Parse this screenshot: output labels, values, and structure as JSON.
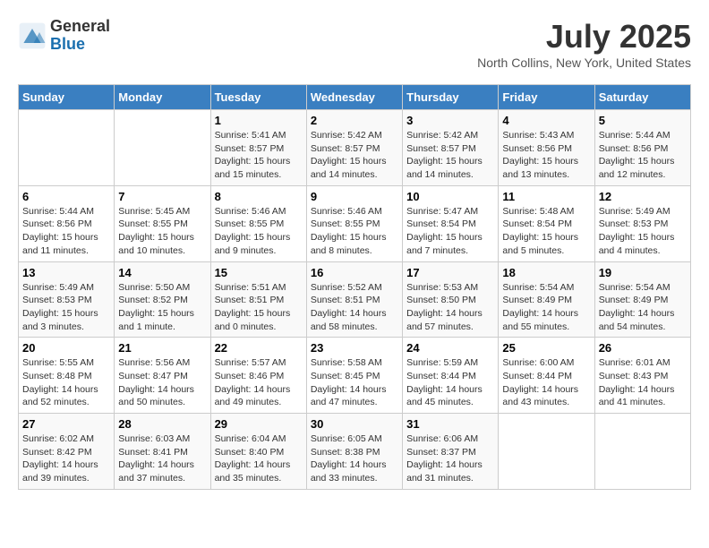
{
  "header": {
    "logo_general": "General",
    "logo_blue": "Blue",
    "title": "July 2025",
    "location": "North Collins, New York, United States"
  },
  "days_of_week": [
    "Sunday",
    "Monday",
    "Tuesday",
    "Wednesday",
    "Thursday",
    "Friday",
    "Saturday"
  ],
  "weeks": [
    [
      {
        "day": "",
        "info": ""
      },
      {
        "day": "",
        "info": ""
      },
      {
        "day": "1",
        "info": "Sunrise: 5:41 AM\nSunset: 8:57 PM\nDaylight: 15 hours and 15 minutes."
      },
      {
        "day": "2",
        "info": "Sunrise: 5:42 AM\nSunset: 8:57 PM\nDaylight: 15 hours and 14 minutes."
      },
      {
        "day": "3",
        "info": "Sunrise: 5:42 AM\nSunset: 8:57 PM\nDaylight: 15 hours and 14 minutes."
      },
      {
        "day": "4",
        "info": "Sunrise: 5:43 AM\nSunset: 8:56 PM\nDaylight: 15 hours and 13 minutes."
      },
      {
        "day": "5",
        "info": "Sunrise: 5:44 AM\nSunset: 8:56 PM\nDaylight: 15 hours and 12 minutes."
      }
    ],
    [
      {
        "day": "6",
        "info": "Sunrise: 5:44 AM\nSunset: 8:56 PM\nDaylight: 15 hours and 11 minutes."
      },
      {
        "day": "7",
        "info": "Sunrise: 5:45 AM\nSunset: 8:55 PM\nDaylight: 15 hours and 10 minutes."
      },
      {
        "day": "8",
        "info": "Sunrise: 5:46 AM\nSunset: 8:55 PM\nDaylight: 15 hours and 9 minutes."
      },
      {
        "day": "9",
        "info": "Sunrise: 5:46 AM\nSunset: 8:55 PM\nDaylight: 15 hours and 8 minutes."
      },
      {
        "day": "10",
        "info": "Sunrise: 5:47 AM\nSunset: 8:54 PM\nDaylight: 15 hours and 7 minutes."
      },
      {
        "day": "11",
        "info": "Sunrise: 5:48 AM\nSunset: 8:54 PM\nDaylight: 15 hours and 5 minutes."
      },
      {
        "day": "12",
        "info": "Sunrise: 5:49 AM\nSunset: 8:53 PM\nDaylight: 15 hours and 4 minutes."
      }
    ],
    [
      {
        "day": "13",
        "info": "Sunrise: 5:49 AM\nSunset: 8:53 PM\nDaylight: 15 hours and 3 minutes."
      },
      {
        "day": "14",
        "info": "Sunrise: 5:50 AM\nSunset: 8:52 PM\nDaylight: 15 hours and 1 minute."
      },
      {
        "day": "15",
        "info": "Sunrise: 5:51 AM\nSunset: 8:51 PM\nDaylight: 15 hours and 0 minutes."
      },
      {
        "day": "16",
        "info": "Sunrise: 5:52 AM\nSunset: 8:51 PM\nDaylight: 14 hours and 58 minutes."
      },
      {
        "day": "17",
        "info": "Sunrise: 5:53 AM\nSunset: 8:50 PM\nDaylight: 14 hours and 57 minutes."
      },
      {
        "day": "18",
        "info": "Sunrise: 5:54 AM\nSunset: 8:49 PM\nDaylight: 14 hours and 55 minutes."
      },
      {
        "day": "19",
        "info": "Sunrise: 5:54 AM\nSunset: 8:49 PM\nDaylight: 14 hours and 54 minutes."
      }
    ],
    [
      {
        "day": "20",
        "info": "Sunrise: 5:55 AM\nSunset: 8:48 PM\nDaylight: 14 hours and 52 minutes."
      },
      {
        "day": "21",
        "info": "Sunrise: 5:56 AM\nSunset: 8:47 PM\nDaylight: 14 hours and 50 minutes."
      },
      {
        "day": "22",
        "info": "Sunrise: 5:57 AM\nSunset: 8:46 PM\nDaylight: 14 hours and 49 minutes."
      },
      {
        "day": "23",
        "info": "Sunrise: 5:58 AM\nSunset: 8:45 PM\nDaylight: 14 hours and 47 minutes."
      },
      {
        "day": "24",
        "info": "Sunrise: 5:59 AM\nSunset: 8:44 PM\nDaylight: 14 hours and 45 minutes."
      },
      {
        "day": "25",
        "info": "Sunrise: 6:00 AM\nSunset: 8:44 PM\nDaylight: 14 hours and 43 minutes."
      },
      {
        "day": "26",
        "info": "Sunrise: 6:01 AM\nSunset: 8:43 PM\nDaylight: 14 hours and 41 minutes."
      }
    ],
    [
      {
        "day": "27",
        "info": "Sunrise: 6:02 AM\nSunset: 8:42 PM\nDaylight: 14 hours and 39 minutes."
      },
      {
        "day": "28",
        "info": "Sunrise: 6:03 AM\nSunset: 8:41 PM\nDaylight: 14 hours and 37 minutes."
      },
      {
        "day": "29",
        "info": "Sunrise: 6:04 AM\nSunset: 8:40 PM\nDaylight: 14 hours and 35 minutes."
      },
      {
        "day": "30",
        "info": "Sunrise: 6:05 AM\nSunset: 8:38 PM\nDaylight: 14 hours and 33 minutes."
      },
      {
        "day": "31",
        "info": "Sunrise: 6:06 AM\nSunset: 8:37 PM\nDaylight: 14 hours and 31 minutes."
      },
      {
        "day": "",
        "info": ""
      },
      {
        "day": "",
        "info": ""
      }
    ]
  ]
}
